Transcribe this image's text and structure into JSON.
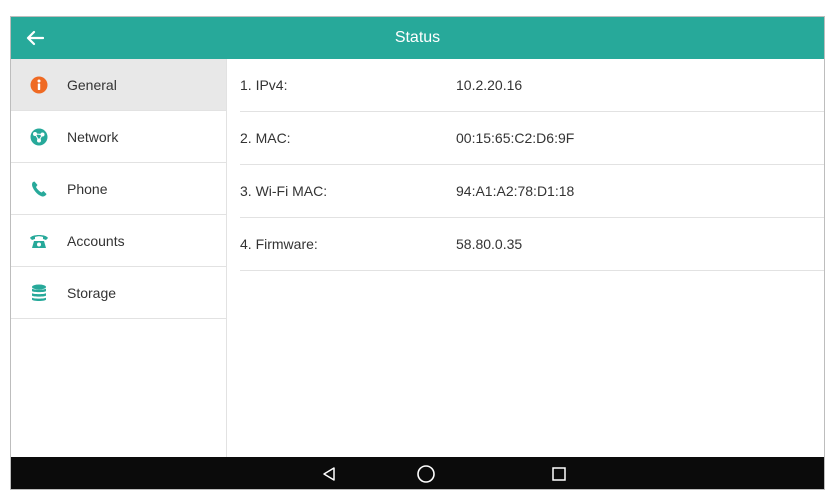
{
  "header": {
    "title": "Status"
  },
  "sidebar": {
    "items": [
      {
        "label": "General",
        "icon": "info-icon",
        "active": true
      },
      {
        "label": "Network",
        "icon": "network-icon",
        "active": false
      },
      {
        "label": "Phone",
        "icon": "phone-icon",
        "active": false
      },
      {
        "label": "Accounts",
        "icon": "desk-phone-icon",
        "active": false
      },
      {
        "label": "Storage",
        "icon": "database-icon",
        "active": false
      }
    ]
  },
  "main": {
    "rows": [
      {
        "label": "1. IPv4:",
        "value": "10.2.20.16"
      },
      {
        "label": "2. MAC:",
        "value": "00:15:65:C2:D6:9F"
      },
      {
        "label": "3. Wi-Fi MAC:",
        "value": "94:A1:A2:78:D1:18"
      },
      {
        "label": "4. Firmware:",
        "value": "58.80.0.35"
      }
    ]
  },
  "navbar": {
    "buttons": [
      "back-triangle-icon",
      "home-circle-icon",
      "recents-square-icon"
    ]
  },
  "colors": {
    "header": "#27a99a",
    "icon_info": "#ef6a23",
    "icon_network": "#27a99a",
    "icon_phone": "#27a99a",
    "icon_accounts": "#27a99a",
    "icon_storage": "#27a99a",
    "navbar": "#0b0b0b"
  }
}
